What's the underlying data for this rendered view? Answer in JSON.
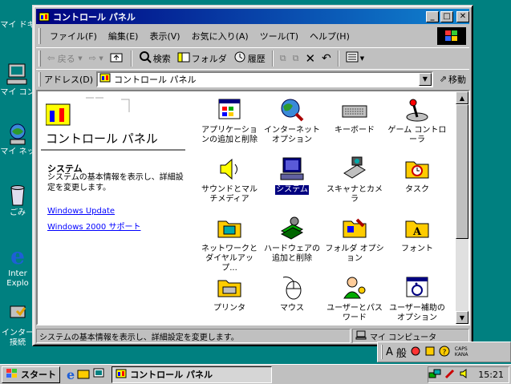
{
  "desktop": {
    "icons": [
      {
        "label": "マイ ドキ",
        "icon": "my-documents-icon"
      },
      {
        "label": "マイ コン",
        "icon": "my-computer-icon"
      },
      {
        "label": "マイ ネッ",
        "icon": "network-icon"
      },
      {
        "label": "ごみ",
        "icon": "recycle-bin-icon"
      },
      {
        "label": "Inter",
        "label2": "Explo",
        "icon": "ie-icon"
      },
      {
        "label": "インター",
        "label2": "接続",
        "icon": "connect-icon"
      }
    ]
  },
  "window": {
    "title": "コントロール パネル",
    "menu": [
      "ファイル(F)",
      "編集(E)",
      "表示(V)",
      "お気に入り(A)",
      "ツール(T)",
      "ヘルプ(H)"
    ],
    "toolbar": {
      "back": "戻る",
      "search": "検索",
      "folders": "フォルダ",
      "history": "履歴"
    },
    "address": {
      "label": "アドレス(D)",
      "value": "コントロール パネル",
      "go": "移動"
    },
    "leftpane": {
      "title": "コントロール パネル",
      "heading": "システム",
      "description": "システムの基本情報を表示し、詳細設定を変更します。",
      "links": [
        "Windows Update",
        "Windows 2000 サポート"
      ]
    },
    "items": [
      {
        "label": "アプリケーションの追加と削除",
        "icon": "add-remove-programs-icon"
      },
      {
        "label": "インターネット オプション",
        "icon": "internet-options-icon"
      },
      {
        "label": "キーボード",
        "icon": "keyboard-icon"
      },
      {
        "label": "ゲーム コントローラ",
        "icon": "game-controller-icon"
      },
      {
        "label": "サウンドとマルチメディア",
        "icon": "sound-icon"
      },
      {
        "label": "システム",
        "icon": "system-icon",
        "selected": true
      },
      {
        "label": "スキャナとカメラ",
        "icon": "scanner-camera-icon"
      },
      {
        "label": "タスク",
        "icon": "scheduled-tasks-icon"
      },
      {
        "label": "ネットワークとダイヤルアップ...",
        "icon": "network-dialup-icon"
      },
      {
        "label": "ハードウェアの追加と削除",
        "icon": "add-hardware-icon"
      },
      {
        "label": "フォルダ オプション",
        "icon": "folder-options-icon"
      },
      {
        "label": "フォント",
        "icon": "fonts-icon"
      },
      {
        "label": "プリンタ",
        "icon": "printers-icon"
      },
      {
        "label": "マウス",
        "icon": "mouse-icon"
      },
      {
        "label": "ユーザーとパスワード",
        "icon": "users-passwords-icon"
      },
      {
        "label": "ユーザー補助のオプション",
        "icon": "accessibility-icon"
      }
    ],
    "status": {
      "message": "システムの基本情報を表示し、詳細設定を変更します。",
      "zone": "マイ コンピュータ"
    }
  },
  "ime": {
    "mode": "A",
    "conv": "般",
    "caps": "CAPS",
    "kana": "KANA"
  },
  "taskbar": {
    "start": "スタート",
    "task": "コントロール パネル",
    "clock": "15:21"
  },
  "colors": {
    "desktop": "#008080",
    "title_start": "#000080",
    "title_end": "#1084d0",
    "selection": "#000080",
    "link": "#0000ff"
  }
}
